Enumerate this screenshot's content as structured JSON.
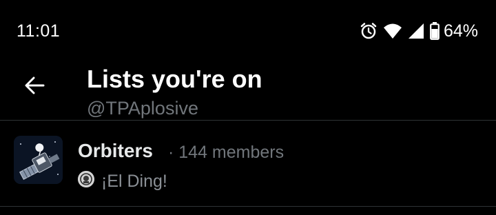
{
  "status_bar": {
    "time": "11:01",
    "battery_percent": "64%",
    "icons": [
      "alarm-icon",
      "wifi-icon",
      "cell-signal-icon",
      "battery-icon"
    ]
  },
  "header": {
    "back_icon": "arrow-left-icon",
    "title": "Lists you're on",
    "subtitle": "@TPAplosive"
  },
  "lists": [
    {
      "name": "Orbiters",
      "meta": "· 144 members",
      "owner": "¡El Ding!",
      "avatar_icon": "satellite-image",
      "owner_avatar_icon": "owner-avatar-icon"
    }
  ],
  "colors": {
    "background": "#000000",
    "primary_text": "#e7e9ea",
    "secondary_text": "#71767b",
    "divider": "#2f3336"
  }
}
